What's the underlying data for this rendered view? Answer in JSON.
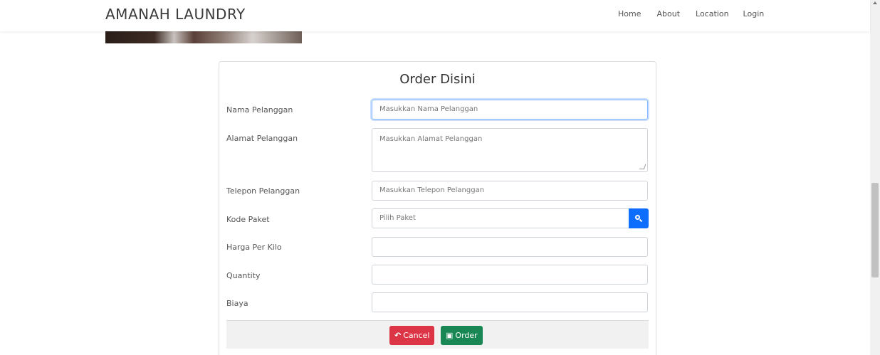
{
  "navbar": {
    "brand": "AMANAH LAUNDRY",
    "links": [
      "Home",
      "About",
      "Location",
      "Login"
    ]
  },
  "form": {
    "title": "Order Disini",
    "fields": [
      {
        "label": "Nama Pelanggan",
        "placeholder": "Masukkan Nama Pelanggan",
        "value": ""
      },
      {
        "label": "Alamat Pelanggan",
        "placeholder": "Masukkan Alamat Pelanggan",
        "value": ""
      },
      {
        "label": "Telepon Pelanggan",
        "placeholder": "Masukkan Telepon Pelanggan",
        "value": ""
      },
      {
        "label": "Kode Paket",
        "placeholder": "Pilih Paket",
        "value": ""
      },
      {
        "label": "Harga Per Kilo",
        "placeholder": "",
        "value": ""
      },
      {
        "label": "Quantity",
        "placeholder": "",
        "value": ""
      },
      {
        "label": "Biaya",
        "placeholder": "",
        "value": ""
      }
    ],
    "buttons": {
      "cancel_label": "Cancel",
      "order_label": "Order"
    },
    "icons": {
      "search": "search-icon",
      "cancel": "undo-icon",
      "order": "save-icon"
    }
  },
  "colors": {
    "primary": "#0d6efd",
    "danger": "#dc3545",
    "success": "#198754"
  }
}
